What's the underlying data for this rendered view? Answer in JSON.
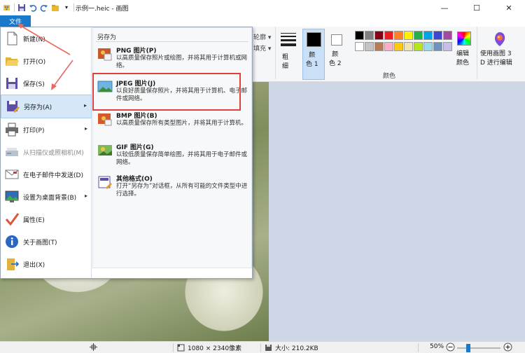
{
  "window": {
    "title": "示例一.heic - 画图",
    "controls": [
      "minimize",
      "maximize",
      "close"
    ]
  },
  "ribbon": {
    "file_tab_label": "文件",
    "outline_label": "轮廓",
    "fill_label": "填充",
    "thickness_label": "粗\n细",
    "color1_label": "颜\n色 1",
    "color2_label": "颜\n色 2",
    "edit_colors_label": "编辑\n颜色",
    "paint3d_label": "使用画图 3\nD 进行编辑",
    "colors_group_label": "颜色",
    "palette_row1": [
      "#000000",
      "#7f7f7f",
      "#880015",
      "#ed1c24",
      "#ff7f27",
      "#fff200",
      "#22b14c",
      "#00a2e8",
      "#3f48cc",
      "#a349a4"
    ],
    "palette_row2": [
      "#ffffff",
      "#c3c3c3",
      "#b97a57",
      "#ffaec9",
      "#ffc90e",
      "#efe4b0",
      "#b5e61d",
      "#99d9ea",
      "#7092be",
      "#c8bfe7"
    ],
    "color1": "#000000",
    "color2": "#ffffff"
  },
  "file_menu": {
    "items": [
      {
        "label": "新建(N)",
        "icon": "new-file-icon",
        "submenu": false,
        "disabled": false
      },
      {
        "label": "打开(O)",
        "icon": "open-folder-icon",
        "submenu": false,
        "disabled": false
      },
      {
        "label": "保存(S)",
        "icon": "save-icon",
        "submenu": false,
        "disabled": false
      },
      {
        "label": "另存为(A)",
        "icon": "save-as-icon",
        "submenu": true,
        "disabled": false
      },
      {
        "label": "打印(P)",
        "icon": "print-icon",
        "submenu": true,
        "disabled": false
      },
      {
        "label": "从扫描仪或照相机(M)",
        "icon": "scanner-icon",
        "submenu": false,
        "disabled": true
      },
      {
        "label": "在电子邮件中发送(D)",
        "icon": "email-icon",
        "submenu": false,
        "disabled": false
      },
      {
        "label": "设置为桌面背景(B)",
        "icon": "desktop-background-icon",
        "submenu": true,
        "disabled": false
      },
      {
        "label": "属性(E)",
        "icon": "properties-check-icon",
        "submenu": false,
        "disabled": false
      },
      {
        "label": "关于画图(T)",
        "icon": "info-icon",
        "submenu": false,
        "disabled": false
      },
      {
        "label": "退出(X)",
        "icon": "exit-icon",
        "submenu": false,
        "disabled": false
      }
    ],
    "save_as_title": "另存为",
    "save_as_options": [
      {
        "title": "PNG 图片(P)",
        "desc": "以高质量保存照片或绘图，并将其用于计算机或网络。",
        "icon": "png-image-icon"
      },
      {
        "title": "JPEG 图片(J)",
        "desc": "以良好质量保存照片，并将其用于计算机、电子邮件或网络。",
        "icon": "jpeg-image-icon"
      },
      {
        "title": "BMP 图片(B)",
        "desc": "以高质量保存所有类型图片，并将其用于计算机。",
        "icon": "bmp-image-icon"
      },
      {
        "title": "GIF 图片(G)",
        "desc": "以较低质量保存简单绘图，并将其用于电子邮件或网络。",
        "icon": "gif-image-icon"
      },
      {
        "title": "其他格式(O)",
        "desc": "打开“另存为”对话框，从所有可能的文件类型中进行选择。",
        "icon": "other-formats-icon"
      }
    ]
  },
  "statusbar": {
    "dimensions": "1080 × 2340像素",
    "size": "大小: 210.2KB",
    "zoom": "50%",
    "zoom_level": 0.5
  }
}
